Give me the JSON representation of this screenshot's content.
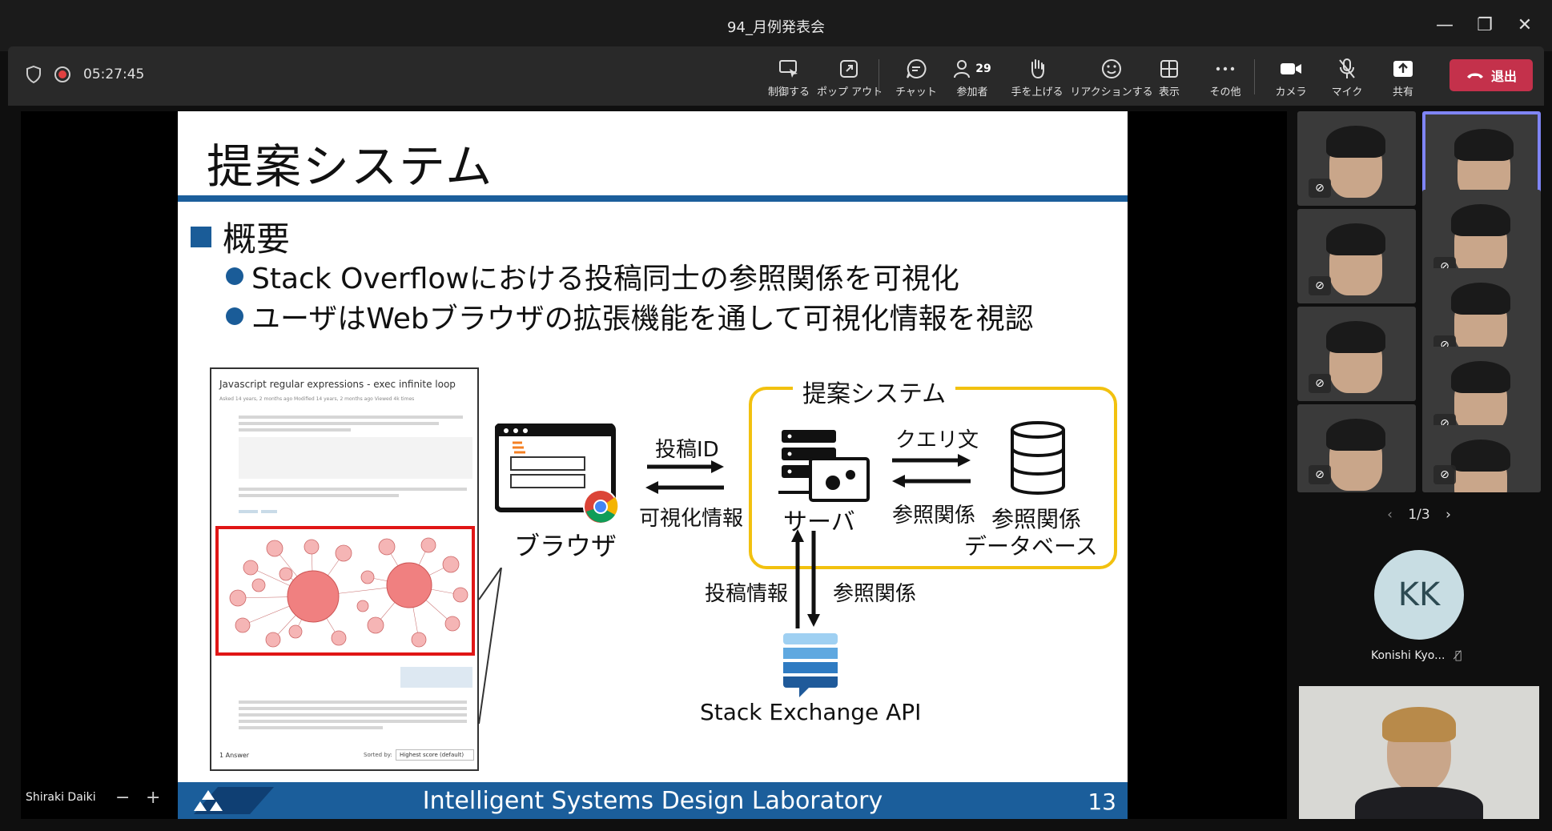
{
  "window": {
    "title": "94_月例発表会"
  },
  "toolbar": {
    "timer": "05:27:45",
    "buttons": [
      {
        "label": "制御する"
      },
      {
        "label": "ポップ アウト"
      },
      {
        "label": "チャット"
      },
      {
        "label": "参加者",
        "badge": "29"
      },
      {
        "label": "手を上げる"
      },
      {
        "label": "リアクションする"
      },
      {
        "label": "表示"
      },
      {
        "label": "その他"
      },
      {
        "label": "カメラ"
      },
      {
        "label": "マイク"
      },
      {
        "label": "共有"
      }
    ],
    "leave_label": "退出"
  },
  "slide": {
    "title": "提案システム",
    "heading": "概要",
    "bullets": [
      "Stack Overflowにおける投稿同士の参照関係を可視化",
      "ユーザはWebブラウザの拡張機能を通して可視化情報を視認"
    ],
    "diagram": {
      "system_label": "提案システム",
      "browser": "ブラウザ",
      "server": "サーバ",
      "database": "参照関係\nデータベース",
      "post_id": "投稿ID",
      "vis_info": "可視化情報",
      "query": "クエリ文",
      "relation_back": "参照関係",
      "post_info": "投稿情報",
      "relation_api": "参照関係",
      "api": "Stack Exchange API"
    },
    "screenshot": {
      "title": "Javascript regular expressions - exec infinite loop",
      "meta": "Asked 14 years, 2 months ago   Modified 14 years, 2 months ago   Viewed 4k times",
      "answers": "1 Answer",
      "sorted_by": "Sorted by:",
      "sort_value": "Highest score (default)"
    },
    "footer": "Intelligent Systems Design Laboratory",
    "page": "13"
  },
  "participants": {
    "pager": "1/3",
    "avatar_initials": "KK",
    "avatar_name": "Konishi Kyo..."
  },
  "presenter_name": "Shiraki Daiki",
  "colors": {
    "accent": "#1b5e9b",
    "leave": "#c4314b",
    "highlight": "#e01616",
    "system_frame": "#f2c10f"
  }
}
